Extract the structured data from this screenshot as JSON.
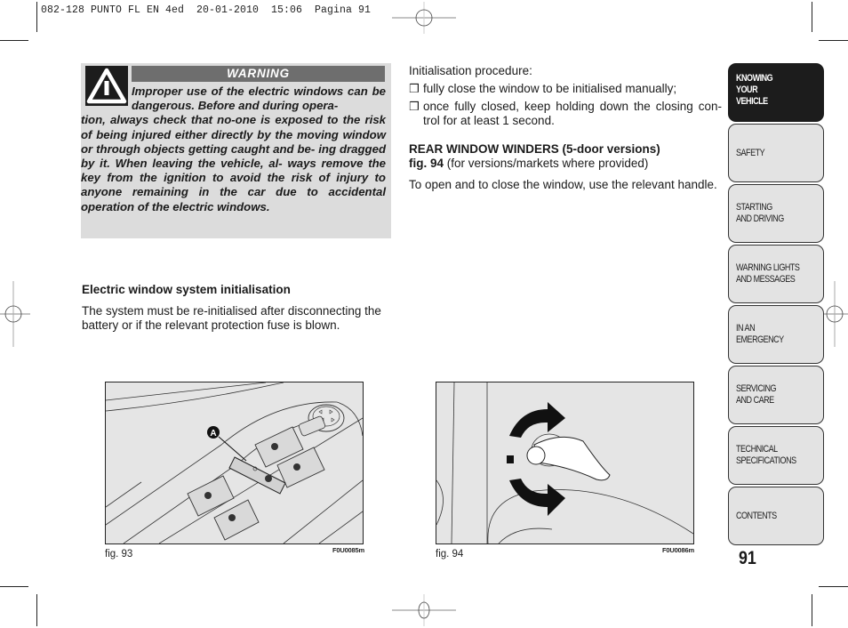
{
  "print_header": "082-128 PUNTO FL EN 4ed  20-01-2010  15:06  Pagina 91",
  "warning": {
    "icon": "warning-triangle-icon",
    "title": "WARNING",
    "text_first": "Improper use of the electric windows can be dangerous. Before and during opera-",
    "text_rest": "tion, always check that no-one is exposed to the risk of being injured either directly by the moving window or through objects getting caught and be- ing dragged by it. When leaving the vehicle, al- ways remove the key from the ignition to avoid the risk of injury to anyone remaining in the car due to accidental operation of the electric windows."
  },
  "left_section": {
    "heading": "Electric window system initialisation",
    "paragraph": "The system must be re-initialised after disconnecting the battery or if the relevant protection fuse is blown."
  },
  "right_section": {
    "intro": "Initialisation procedure:",
    "bullet_glyph": "❒",
    "bullets": [
      "fully close the window to be initialised manually;",
      "once fully closed, keep holding down the closing con- trol for at least 1 second."
    ],
    "rear_heading": "REAR WINDOW WINDERS (5-door versions)",
    "fig_ref_bold": "fig. 94",
    "fig_ref_rest": " (for versions/markets where provided)",
    "paragraph": "To open and to close the window, use the relevant handle."
  },
  "figures": [
    {
      "caption": "fig. 93",
      "code": "F0U0085m",
      "callout": "A"
    },
    {
      "caption": "fig. 94",
      "code": "F0U0086m"
    }
  ],
  "side_tabs": [
    {
      "label": "KNOWING\nYOUR\nVEHICLE",
      "active": true
    },
    {
      "label": "SAFETY",
      "active": false
    },
    {
      "label": "STARTING\nAND DRIVING",
      "active": false
    },
    {
      "label": "WARNING LIGHTS\nAND MESSAGES",
      "active": false
    },
    {
      "label": "IN AN\nEMERGENCY",
      "active": false
    },
    {
      "label": "SERVICING\nAND CARE",
      "active": false
    },
    {
      "label": "TECHNICAL\nSPECIFICATIONS",
      "active": false
    },
    {
      "label": "CONTENTS",
      "active": false
    }
  ],
  "page_number": "91"
}
